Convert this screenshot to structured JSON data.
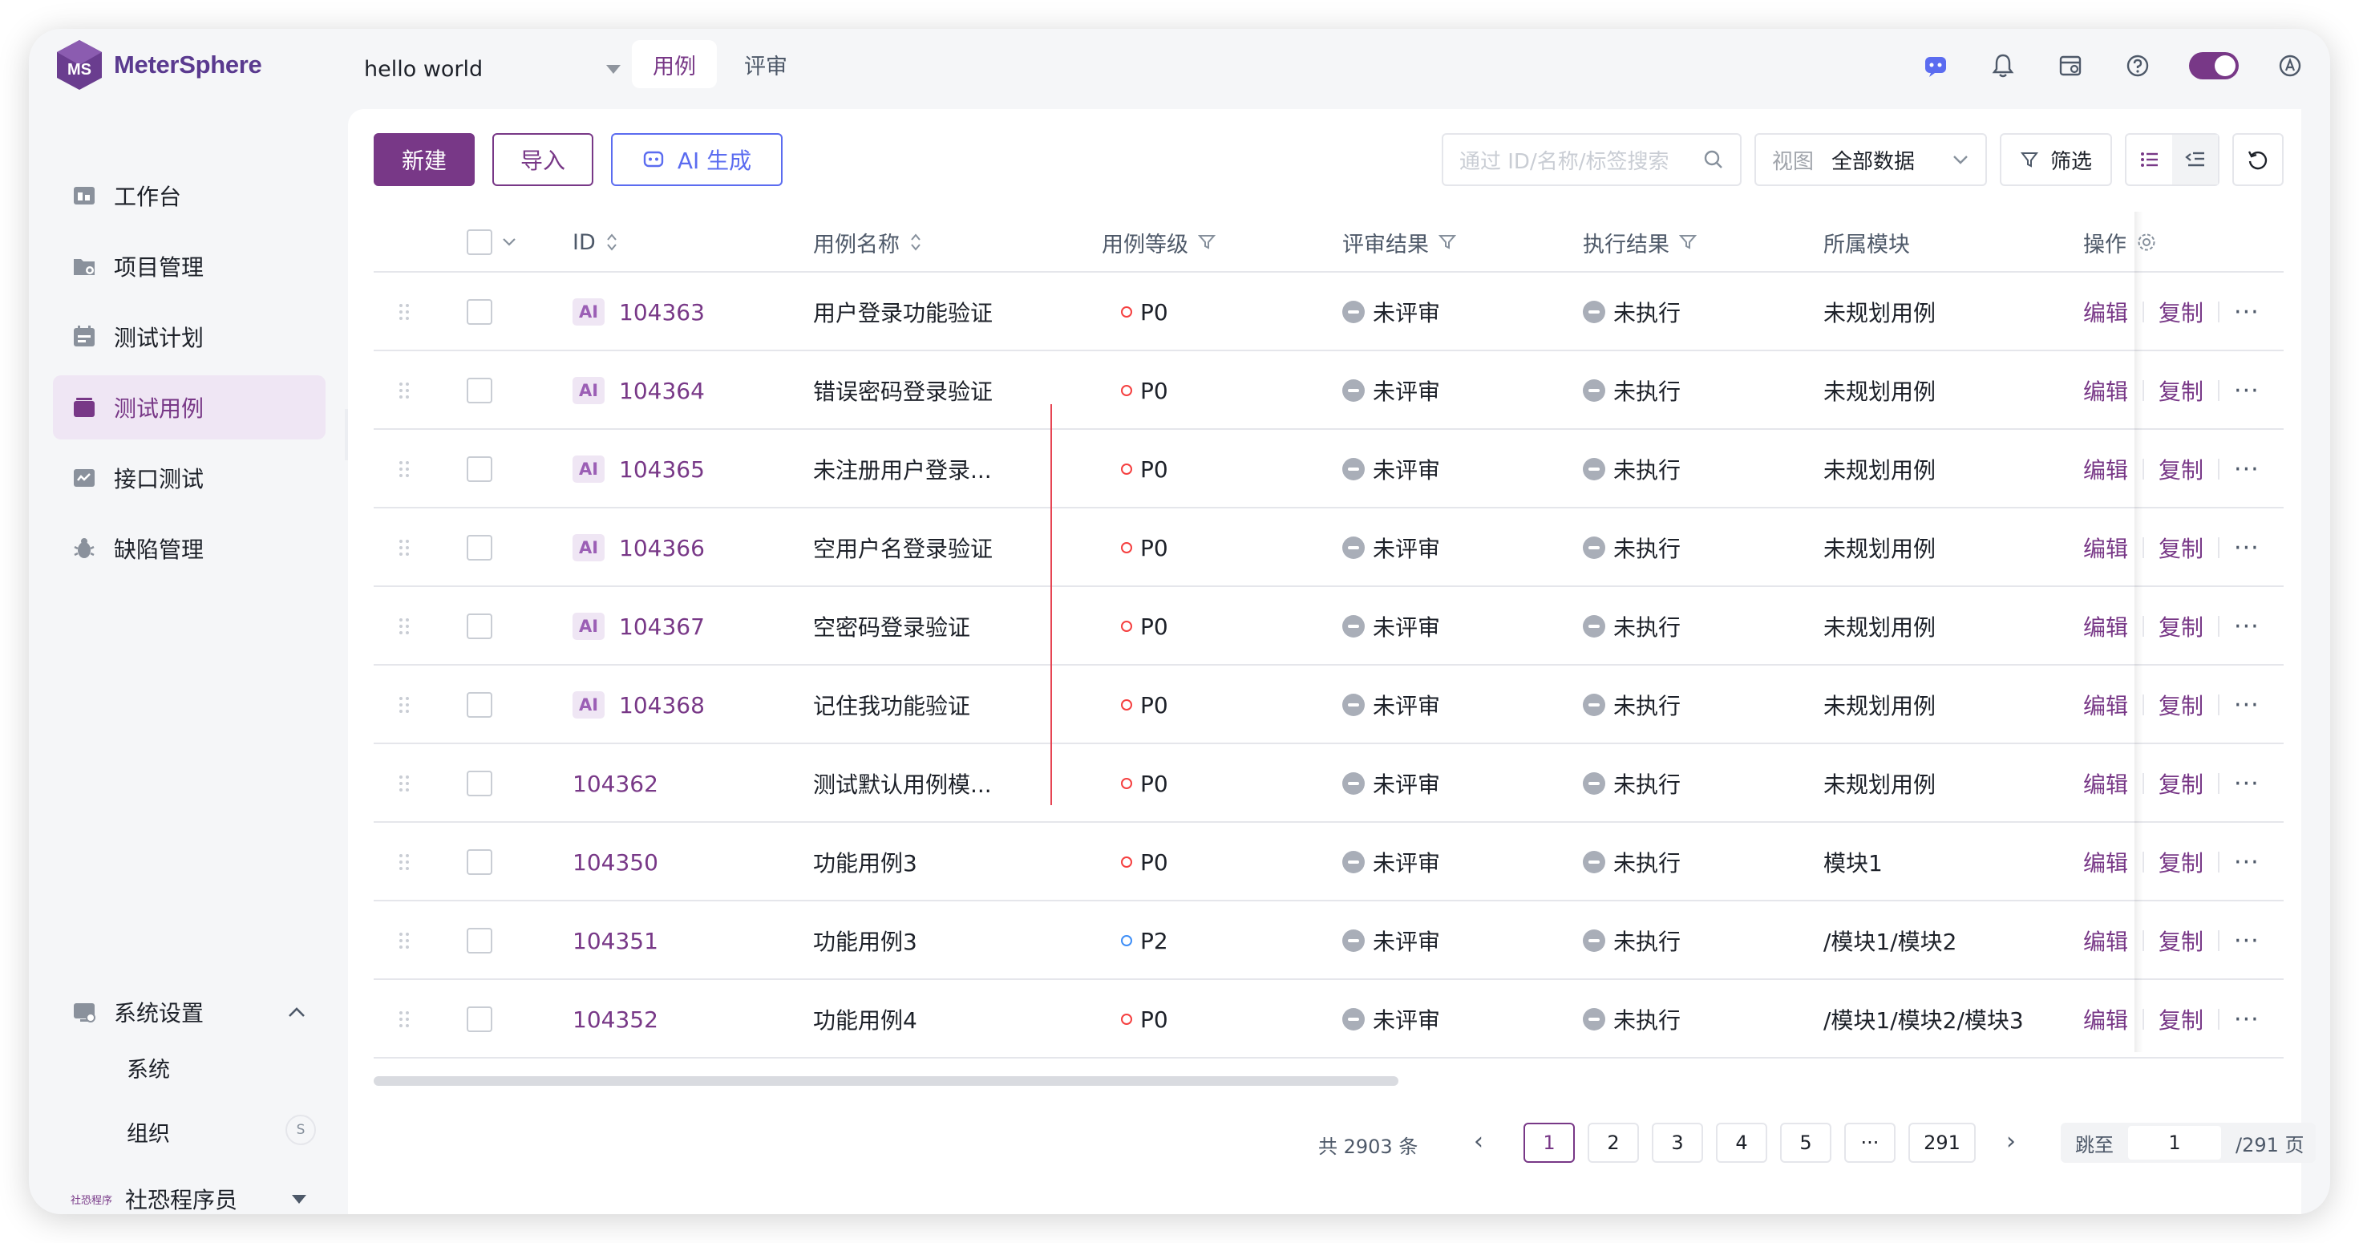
{
  "app": {
    "name": "MeterSphere"
  },
  "project": {
    "name": "hello world"
  },
  "top_tabs": [
    {
      "label": "用例",
      "active": true
    },
    {
      "label": "评审",
      "active": false
    }
  ],
  "sidebar": {
    "items": [
      {
        "label": "工作台",
        "icon": "workbench-icon"
      },
      {
        "label": "项目管理",
        "icon": "project-folder-icon"
      },
      {
        "label": "测试计划",
        "icon": "test-plan-icon"
      },
      {
        "label": "测试用例",
        "icon": "test-case-icon",
        "active": true
      },
      {
        "label": "接口测试",
        "icon": "api-test-icon"
      },
      {
        "label": "缺陷管理",
        "icon": "bug-icon"
      }
    ],
    "settings": {
      "label": "系统设置",
      "sub": [
        "系统",
        "组织"
      ],
      "org_badge": "S"
    },
    "user": {
      "avatar_text": "社恐程序",
      "name": "社恐程序员"
    }
  },
  "toolbar": {
    "new_label": "新建",
    "import_label": "导入",
    "ai_label": "AI 生成",
    "search_placeholder": "通过 ID/名称/标签搜索",
    "view_label": "视图",
    "view_value": "全部数据",
    "filter_label": "筛选"
  },
  "table": {
    "headers": {
      "id": "ID",
      "name": "用例名称",
      "level": "用例等级",
      "review": "评审结果",
      "exec": "执行结果",
      "module": "所属模块",
      "ops": "操作"
    },
    "ai_badge": "AI",
    "op_edit": "编辑",
    "op_copy": "复制",
    "op_more": "···",
    "rows": [
      {
        "ai": true,
        "id": "104363",
        "name": "用户登录功能验证",
        "level": "P0",
        "review": "未评审",
        "exec": "未执行",
        "module": "未规划用例"
      },
      {
        "ai": true,
        "id": "104364",
        "name": "错误密码登录验证",
        "level": "P0",
        "review": "未评审",
        "exec": "未执行",
        "module": "未规划用例"
      },
      {
        "ai": true,
        "id": "104365",
        "name": "未注册用户登录...",
        "level": "P0",
        "review": "未评审",
        "exec": "未执行",
        "module": "未规划用例"
      },
      {
        "ai": true,
        "id": "104366",
        "name": "空用户名登录验证",
        "level": "P0",
        "review": "未评审",
        "exec": "未执行",
        "module": "未规划用例"
      },
      {
        "ai": true,
        "id": "104367",
        "name": "空密码登录验证",
        "level": "P0",
        "review": "未评审",
        "exec": "未执行",
        "module": "未规划用例"
      },
      {
        "ai": true,
        "id": "104368",
        "name": "记住我功能验证",
        "level": "P0",
        "review": "未评审",
        "exec": "未执行",
        "module": "未规划用例"
      },
      {
        "ai": false,
        "id": "104362",
        "name": "测试默认用例模...",
        "level": "P0",
        "review": "未评审",
        "exec": "未执行",
        "module": "未规划用例"
      },
      {
        "ai": false,
        "id": "104350",
        "name": "功能用例3",
        "level": "P0",
        "review": "未评审",
        "exec": "未执行",
        "module": "模块1"
      },
      {
        "ai": false,
        "id": "104351",
        "name": "功能用例3",
        "level": "P2",
        "review": "未评审",
        "exec": "未执行",
        "module": "/模块1/模块2"
      },
      {
        "ai": false,
        "id": "104352",
        "name": "功能用例4",
        "level": "P0",
        "review": "未评审",
        "exec": "未执行",
        "module": "/模块1/模块2/模块3"
      }
    ]
  },
  "pagination": {
    "total_text": "共 2903 条",
    "pages": [
      "1",
      "2",
      "3",
      "4",
      "5",
      "···",
      "291"
    ],
    "current": "1",
    "jump_label": "跳至",
    "jump_value": "1",
    "page_suffix": "/291 页"
  },
  "colors": {
    "accent": "#783887",
    "danger": "#f53f3f",
    "info": "#3e8ef7"
  }
}
